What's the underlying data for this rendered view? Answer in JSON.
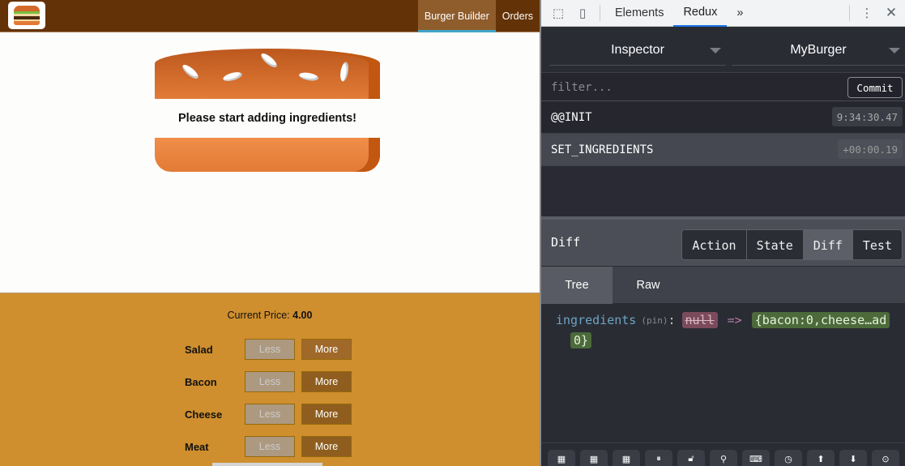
{
  "app": {
    "logo_alt": "burger-logo",
    "nav": [
      {
        "label": "Burger Builder",
        "active": true
      },
      {
        "label": "Orders",
        "active": false
      }
    ],
    "burger_message": "Please start adding ingredients!",
    "price_label": "Current Price:",
    "price_value": "4.00",
    "controls": [
      {
        "label": "Salad",
        "less": "Less",
        "more": "More"
      },
      {
        "label": "Bacon",
        "less": "Less",
        "more": "More"
      },
      {
        "label": "Cheese",
        "less": "Less",
        "more": "More"
      },
      {
        "label": "Meat",
        "less": "Less",
        "more": "More"
      }
    ]
  },
  "devtools": {
    "tabs": [
      {
        "label": "Elements",
        "active": false
      },
      {
        "label": "Redux",
        "active": true
      }
    ],
    "more_tabs_icon": "»",
    "menu_icon": "⋮",
    "close_icon": "✕",
    "monitor_select": "Inspector",
    "instance_select": "MyBurger",
    "filter_placeholder": "filter...",
    "commit_label": "Commit",
    "actions": [
      {
        "name": "@@INIT",
        "time": "9:34:30.47",
        "selected": false
      },
      {
        "name": "SET_INGREDIENTS",
        "time": "+00:00.19",
        "selected": true
      }
    ],
    "panel_title": "Diff",
    "panel_tabs": [
      {
        "label": "Action",
        "active": false
      },
      {
        "label": "State",
        "active": false
      },
      {
        "label": "Diff",
        "active": true
      },
      {
        "label": "Test",
        "active": false
      }
    ],
    "view_tabs": [
      {
        "label": "Tree",
        "active": true
      },
      {
        "label": "Raw",
        "active": false
      }
    ],
    "diff": {
      "key": "ingredients",
      "pin": "(pin)",
      "colon": ":",
      "old_value": "null",
      "arrow": "=>",
      "new_value_line1": "{bacon:0,cheese…ad",
      "new_value_line2": "0}"
    },
    "bottom_toolbar": [
      "dock-left-icon",
      "dock-right-icon",
      "dock-bottom-icon",
      "pause-icon",
      "lock-icon",
      "pin-icon",
      "keyboard-icon",
      "timer-icon",
      "upload-icon",
      "download-icon",
      "remote-icon"
    ]
  }
}
